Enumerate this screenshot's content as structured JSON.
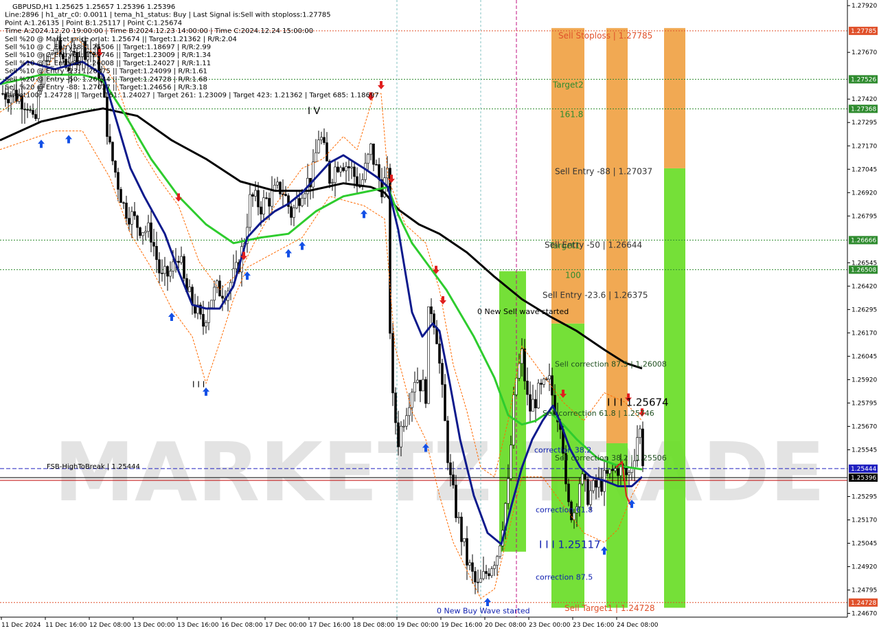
{
  "colors": {
    "background": "#ffffff",
    "bull_candle": "#000000",
    "bear_candle": "#000000",
    "ma_slow": "#000000",
    "ma_mid": "#2ecc2e",
    "ma_fast": "#0d1a8c",
    "channel": "#ff6a00",
    "sell_zone_orange": "#f0a040",
    "sell_zone_green": "#66dd22",
    "level_dotted": "#2e8b2e",
    "stoploss_line": "#e0502a",
    "fsb_line": "#2020c0",
    "current_price_line": "#c00000",
    "arrow_up": "#1450e6",
    "arrow_down": "#e01e1e",
    "magenta_line": "#c01080",
    "watermark": "#cccccc"
  },
  "info_panel": [
    "GBPUSD,H1  1.25625 1.25657 1.25396 1.25396",
    "Line:2896  |  h1_atr_c0: 0.0011  |  tema_h1_status: Buy  |  Last Signal is:Sell with stoploss:1.27785",
    "Point A:1.26135  |  Point B:1.25117  |  Point C:1.25674",
    "Time A:2024.12.20 19:00:00  |  Time B:2024.12.23 14:00:00  |  Time C:2024.12.24 15:00:00",
    "Sell %20 @ Market price or at: 1.25674  ||  Target:1.21362  |  R/R:2.04",
    "Sell %10 @ C_Entry38: 1.25506  ||  Target:1.18697  |  R/R:2.99",
    "Sell %10 @ C_Entry61: 1.25746  ||  Target:1.23009  |  R/R:1.34",
    "Sell %10 @ C_Entry88: 1.26008  ||  Target:1.24027  |  R/R:1.11",
    "Sell %10 @ Entry -23: 1.26375  ||  Target:1.24099  |  R/R:1.61",
    "Sell %20 @ Entry -50: 1.26644  ||  Target:1.24728  |  R/R:1.68",
    "Sell %20 @ Entry -88: 1.27037  ||  Target:1.24656  |  R/R:3.18",
    "Target100: 1.24728  ||  Target 161: 1.24027  |  Target 261: 1.23009  |  Target 423: 1.21362  |  Target 685: 1.18697"
  ],
  "chart_data": {
    "type": "candlestick",
    "symbol": "GBPUSD,H1",
    "ylim": [
      1.2465,
      1.2795
    ],
    "y_ticks": [
      "1.27920",
      "1.27670",
      "1.27420",
      "1.27295",
      "1.27170",
      "1.27045",
      "1.26920",
      "1.26795",
      "1.26545",
      "1.26420",
      "1.26295",
      "1.26170",
      "1.26045",
      "1.25920",
      "1.25795",
      "1.25670",
      "1.25545",
      "1.25295",
      "1.25170",
      "1.25045",
      "1.24920",
      "1.24795",
      "1.24670"
    ],
    "x_ticks": [
      "11 Dec 2024",
      "11 Dec 16:00",
      "12 Dec 08:00",
      "13 Dec 00:00",
      "13 Dec 16:00",
      "16 Dec 08:00",
      "17 Dec 00:00",
      "17 Dec 16:00",
      "18 Dec 08:00",
      "19 Dec 00:00",
      "19 Dec 16:00",
      "20 Dec 08:00",
      "23 Dec 00:00",
      "23 Dec 16:00",
      "24 Dec 08:00"
    ],
    "price_path": [
      [
        0,
        1.2745
      ],
      [
        20,
        1.2745
      ],
      [
        40,
        1.274
      ],
      [
        50,
        1.2725
      ],
      [
        60,
        1.2755
      ],
      [
        80,
        1.277
      ],
      [
        100,
        1.276
      ],
      [
        120,
        1.277
      ],
      [
        140,
        1.2765
      ],
      [
        150,
        1.2745
      ],
      [
        160,
        1.2715
      ],
      [
        170,
        1.27
      ],
      [
        180,
        1.2685
      ],
      [
        200,
        1.2675
      ],
      [
        220,
        1.267
      ],
      [
        235,
        1.2645
      ],
      [
        250,
        1.265
      ],
      [
        260,
        1.266
      ],
      [
        270,
        1.264
      ],
      [
        285,
        1.263
      ],
      [
        295,
        1.262
      ],
      [
        305,
        1.2635
      ],
      [
        315,
        1.264
      ],
      [
        330,
        1.264
      ],
      [
        345,
        1.265
      ],
      [
        355,
        1.2665
      ],
      [
        365,
        1.269
      ],
      [
        380,
        1.2685
      ],
      [
        395,
        1.269
      ],
      [
        410,
        1.2695
      ],
      [
        425,
        1.268
      ],
      [
        440,
        1.2695
      ],
      [
        455,
        1.27
      ],
      [
        465,
        1.2725
      ],
      [
        480,
        1.27
      ],
      [
        495,
        1.271
      ],
      [
        510,
        1.2705
      ],
      [
        525,
        1.2695
      ],
      [
        540,
        1.2715
      ],
      [
        555,
        1.2695
      ],
      [
        565,
        1.27
      ],
      [
        568,
        1.262
      ],
      [
        572,
        1.258
      ],
      [
        580,
        1.256
      ],
      [
        590,
        1.2575
      ],
      [
        605,
        1.2595
      ],
      [
        620,
        1.2585
      ],
      [
        625,
        1.2635
      ],
      [
        635,
        1.262
      ],
      [
        645,
        1.258
      ],
      [
        655,
        1.254
      ],
      [
        665,
        1.252
      ],
      [
        680,
        1.2495
      ],
      [
        695,
        1.248
      ],
      [
        710,
        1.249
      ],
      [
        725,
        1.25
      ],
      [
        740,
        1.2535
      ],
      [
        750,
        1.259
      ],
      [
        760,
        1.2605
      ],
      [
        770,
        1.2575
      ],
      [
        785,
        1.2585
      ],
      [
        800,
        1.259
      ],
      [
        810,
        1.2575
      ],
      [
        818,
        1.257
      ],
      [
        825,
        1.2525
      ],
      [
        835,
        1.252
      ],
      [
        845,
        1.254
      ],
      [
        855,
        1.253
      ],
      [
        870,
        1.2535
      ],
      [
        885,
        1.254
      ],
      [
        900,
        1.2545
      ],
      [
        915,
        1.254
      ],
      [
        925,
        1.2555
      ],
      [
        930,
        1.2567
      ],
      [
        935,
        1.256
      ],
      [
        937,
        1.25396
      ]
    ],
    "ma_slow": [
      [
        0,
        1.272
      ],
      [
        60,
        1.273
      ],
      [
        120,
        1.2735
      ],
      [
        150,
        1.2737
      ],
      [
        200,
        1.2733
      ],
      [
        250,
        1.272
      ],
      [
        300,
        1.271
      ],
      [
        350,
        1.2698
      ],
      [
        400,
        1.2693
      ],
      [
        450,
        1.2693
      ],
      [
        500,
        1.2697
      ],
      [
        540,
        1.2695
      ],
      [
        560,
        1.2692
      ],
      [
        580,
        1.2683
      ],
      [
        610,
        1.2675
      ],
      [
        640,
        1.267
      ],
      [
        680,
        1.266
      ],
      [
        720,
        1.2647
      ],
      [
        760,
        1.2635
      ],
      [
        800,
        1.2626
      ],
      [
        840,
        1.2618
      ],
      [
        880,
        1.2608
      ],
      [
        910,
        1.2601
      ],
      [
        935,
        1.2598
      ]
    ],
    "ma_mid": [
      [
        0,
        1.275
      ],
      [
        60,
        1.2755
      ],
      [
        120,
        1.2755
      ],
      [
        150,
        1.2752
      ],
      [
        180,
        1.2735
      ],
      [
        220,
        1.271
      ],
      [
        260,
        1.269
      ],
      [
        300,
        1.2675
      ],
      [
        340,
        1.2665
      ],
      [
        380,
        1.2668
      ],
      [
        420,
        1.267
      ],
      [
        460,
        1.2682
      ],
      [
        500,
        1.269
      ],
      [
        540,
        1.2693
      ],
      [
        565,
        1.2695
      ],
      [
        580,
        1.268
      ],
      [
        600,
        1.2665
      ],
      [
        620,
        1.2655
      ],
      [
        650,
        1.264
      ],
      [
        690,
        1.2615
      ],
      [
        720,
        1.2593
      ],
      [
        740,
        1.2573
      ],
      [
        760,
        1.2568
      ],
      [
        780,
        1.257
      ],
      [
        800,
        1.2575
      ],
      [
        820,
        1.2568
      ],
      [
        840,
        1.256
      ],
      [
        870,
        1.255
      ],
      [
        900,
        1.2546
      ],
      [
        935,
        1.2544
      ]
    ],
    "ma_fast": [
      [
        0,
        1.275
      ],
      [
        40,
        1.2762
      ],
      [
        80,
        1.2758
      ],
      [
        120,
        1.2762
      ],
      [
        150,
        1.2755
      ],
      [
        170,
        1.273
      ],
      [
        190,
        1.2705
      ],
      [
        210,
        1.269
      ],
      [
        240,
        1.267
      ],
      [
        260,
        1.265
      ],
      [
        280,
        1.2632
      ],
      [
        300,
        1.263
      ],
      [
        320,
        1.263
      ],
      [
        340,
        1.2642
      ],
      [
        360,
        1.2668
      ],
      [
        380,
        1.2676
      ],
      [
        400,
        1.2682
      ],
      [
        420,
        1.2686
      ],
      [
        440,
        1.2692
      ],
      [
        460,
        1.27
      ],
      [
        480,
        1.2708
      ],
      [
        500,
        1.2712
      ],
      [
        530,
        1.2705
      ],
      [
        550,
        1.27
      ],
      [
        565,
        1.2695
      ],
      [
        580,
        1.2672
      ],
      [
        590,
        1.265
      ],
      [
        600,
        1.2628
      ],
      [
        615,
        1.2615
      ],
      [
        630,
        1.2622
      ],
      [
        640,
        1.2618
      ],
      [
        655,
        1.259
      ],
      [
        670,
        1.256
      ],
      [
        690,
        1.253
      ],
      [
        710,
        1.251
      ],
      [
        730,
        1.2504
      ],
      [
        745,
        1.2525
      ],
      [
        760,
        1.2545
      ],
      [
        775,
        1.256
      ],
      [
        790,
        1.257
      ],
      [
        805,
        1.2578
      ],
      [
        815,
        1.257
      ],
      [
        830,
        1.2555
      ],
      [
        845,
        1.2545
      ],
      [
        860,
        1.254
      ],
      [
        880,
        1.2538
      ],
      [
        900,
        1.2535
      ],
      [
        920,
        1.2535
      ],
      [
        935,
        1.254
      ]
    ],
    "channel_upper": [
      [
        0,
        1.2735
      ],
      [
        40,
        1.2745
      ],
      [
        80,
        1.2765
      ],
      [
        110,
        1.2775
      ],
      [
        140,
        1.2765
      ],
      [
        170,
        1.275
      ],
      [
        200,
        1.2718
      ],
      [
        230,
        1.27
      ],
      [
        260,
        1.2685
      ],
      [
        290,
        1.2655
      ],
      [
        320,
        1.264
      ],
      [
        350,
        1.265
      ],
      [
        370,
        1.2665
      ],
      [
        400,
        1.2685
      ],
      [
        440,
        1.2705
      ],
      [
        470,
        1.271
      ],
      [
        500,
        1.2722
      ],
      [
        520,
        1.2715
      ],
      [
        545,
        1.2745
      ],
      [
        555,
        1.2745
      ],
      [
        565,
        1.27
      ],
      [
        590,
        1.2675
      ],
      [
        620,
        1.2665
      ],
      [
        640,
        1.264
      ],
      [
        660,
        1.26
      ],
      [
        680,
        1.2575
      ],
      [
        700,
        1.2545
      ],
      [
        720,
        1.254
      ],
      [
        740,
        1.257
      ],
      [
        760,
        1.261
      ],
      [
        790,
        1.2595
      ],
      [
        820,
        1.258
      ],
      [
        850,
        1.257
      ],
      [
        880,
        1.2585
      ],
      [
        910,
        1.258
      ],
      [
        935,
        1.257
      ]
    ],
    "channel_lower": [
      [
        0,
        1.2715
      ],
      [
        40,
        1.272
      ],
      [
        80,
        1.2725
      ],
      [
        120,
        1.2725
      ],
      [
        160,
        1.27
      ],
      [
        190,
        1.267
      ],
      [
        220,
        1.2652
      ],
      [
        250,
        1.263
      ],
      [
        280,
        1.2615
      ],
      [
        300,
        1.259
      ],
      [
        320,
        1.2612
      ],
      [
        340,
        1.2635
      ],
      [
        360,
        1.2652
      ],
      [
        400,
        1.266
      ],
      [
        440,
        1.2668
      ],
      [
        480,
        1.269
      ],
      [
        500,
        1.2688
      ],
      [
        530,
        1.2685
      ],
      [
        560,
        1.2678
      ],
      [
        575,
        1.261
      ],
      [
        600,
        1.2575
      ],
      [
        620,
        1.256
      ],
      [
        640,
        1.253
      ],
      [
        660,
        1.2505
      ],
      [
        680,
        1.249
      ],
      [
        700,
        1.2475
      ],
      [
        720,
        1.248
      ],
      [
        740,
        1.251
      ],
      [
        760,
        1.254
      ],
      [
        790,
        1.254
      ],
      [
        820,
        1.2525
      ],
      [
        850,
        1.251
      ],
      [
        880,
        1.2505
      ],
      [
        900,
        1.2512
      ],
      [
        920,
        1.253
      ],
      [
        935,
        1.254
      ]
    ],
    "levels": [
      {
        "price": 1.27785,
        "label": "1.27785",
        "color": "#e0502a",
        "style": "dotted"
      },
      {
        "price": 1.27526,
        "label": "1.27526",
        "color": "#2e8b2e",
        "style": "dotted"
      },
      {
        "price": 1.27368,
        "label": "1.27368",
        "color": "#2e8b2e",
        "style": "dotted"
      },
      {
        "price": 1.26666,
        "label": "1.26666",
        "color": "#2e8b2e",
        "style": "dotted"
      },
      {
        "price": 1.26508,
        "label": "1.26508",
        "color": "#2e8b2e",
        "style": "dotted"
      },
      {
        "price": 1.25444,
        "label": "1.25444",
        "color": "#2020c0",
        "style": "dashed"
      },
      {
        "price": 1.25396,
        "label": "1.25396",
        "color": "#000000",
        "style": "solid"
      },
      {
        "price": 1.24728,
        "label": "1.24728",
        "color": "#e0502a",
        "style": "dotted"
      }
    ],
    "zone_labels": [
      {
        "text": "Sell Stoploss | 1.27785",
        "price": 1.27785,
        "color": "#e0502a"
      },
      {
        "text": "Target2",
        "price": 1.27526,
        "color": "#2e8b2e"
      },
      {
        "text": "161.8",
        "price": 1.27368,
        "color": "#2e8b2e"
      },
      {
        "text": "Sell Entry -88 | 1.27037",
        "price": 1.27037,
        "color": "#333333"
      },
      {
        "text": "Target1",
        "price": 1.26666,
        "color": "#2e8b2e"
      },
      {
        "text": "Sell Entry -50 | 1.26644",
        "price": 1.26644,
        "color": "#333333"
      },
      {
        "text": "100",
        "price": 1.26508,
        "color": "#2e8b2e"
      },
      {
        "text": "Sell Entry -23.6 | 1.26375",
        "price": 1.26375,
        "color": "#333333"
      },
      {
        "text": "Sell correction 87.5 | 1.26008",
        "price": 1.26008,
        "color": "#205020"
      },
      {
        "text": "Sell correction 61.8 | 1.25746",
        "price": 1.25746,
        "color": "#205020"
      },
      {
        "text": "Sell correction 38.2 | 1.25506",
        "price": 1.25506,
        "color": "#205020"
      },
      {
        "text": "Sell Target1 | 1.24728",
        "price": 1.24728,
        "color": "#e0502a"
      }
    ],
    "annotations": [
      {
        "text": "I V",
        "price": 1.2734,
        "color": "#000000"
      },
      {
        "text": "I I I",
        "price": 1.2588,
        "color": "#000000"
      },
      {
        "text": "0 New Sell wave started",
        "price": 1.2627,
        "color": "#000000"
      },
      {
        "text": "I I I 1.25674",
        "price": 1.2578,
        "color": "#000000"
      },
      {
        "text": "correction 38.2",
        "price": 1.2553,
        "color": "#1020b0"
      },
      {
        "text": "correction 61.8",
        "price": 1.2521,
        "color": "#1020b0"
      },
      {
        "text": "I I I 1.25117",
        "price": 1.2502,
        "color": "#1020b0"
      },
      {
        "text": "correction 87.5",
        "price": 1.2485,
        "color": "#1020b0"
      },
      {
        "text": "0 New Buy Wave started",
        "price": 1.2467,
        "color": "#1020b0"
      },
      {
        "text": "FSB-HighToBreak | 1.25444",
        "price": 1.25444,
        "color": "#000000"
      }
    ],
    "zones": [
      {
        "from": 1.25,
        "to": 1.265,
        "color": "#66dd22"
      },
      {
        "from": 1.247,
        "to": 1.2622,
        "color": "#66dd22"
      },
      {
        "from": 1.2622,
        "to": 1.278,
        "color": "#f0a040"
      },
      {
        "from": 1.247,
        "to": 1.2558,
        "color": "#66dd22"
      },
      {
        "from": 1.2558,
        "to": 1.278,
        "color": "#f0a040"
      },
      {
        "from": 1.247,
        "to": 1.2705,
        "color": "#66dd22"
      },
      {
        "from": 1.2705,
        "to": 1.278,
        "color": "#f0a040"
      }
    ],
    "signals_up": [
      60,
      100,
      250,
      300,
      360,
      420,
      440,
      530,
      620,
      710,
      880,
      920
    ],
    "signals_down": [
      145,
      260,
      355,
      540,
      555,
      570,
      635,
      645,
      820,
      915,
      935
    ],
    "watermark": "MARKETZITRADE"
  }
}
